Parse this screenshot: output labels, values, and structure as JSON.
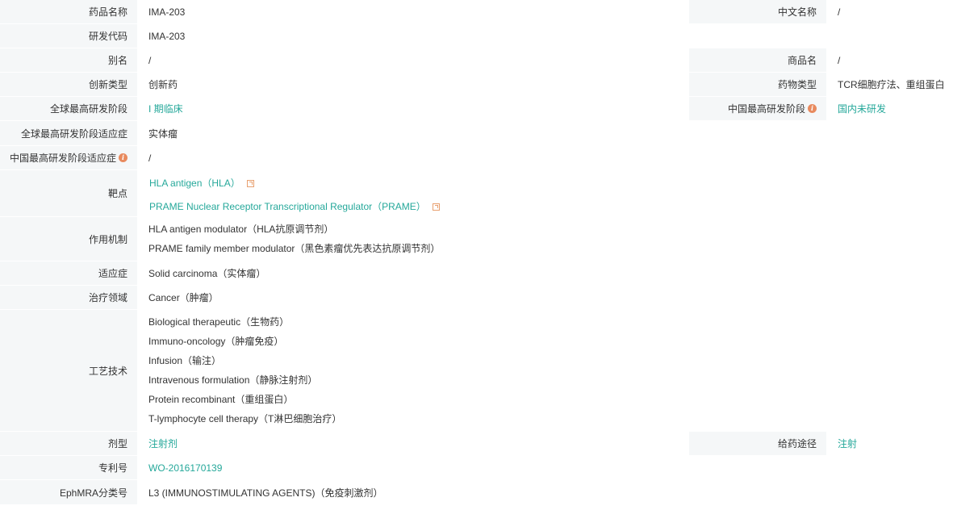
{
  "labels": {
    "drug_name": "药品名称",
    "chinese_name": "中文名称",
    "rd_code": "研发代码",
    "alias": "别名",
    "trade_name": "商品名",
    "innovation_type": "创新类型",
    "drug_type": "药物类型",
    "global_highest_phase": "全球最高研发阶段",
    "china_highest_phase": "中国最高研发阶段",
    "global_phase_indication": "全球最高研发阶段适应症",
    "china_phase_indication": "中国最高研发阶段适应症",
    "target": "靶点",
    "mechanism": "作用机制",
    "indication": "适应症",
    "therapeutic_area": "治疗领域",
    "technology": "工艺技术",
    "dosage_form": "剂型",
    "route": "给药途径",
    "patent": "专利号",
    "ephmra": "EphMRA分类号"
  },
  "values": {
    "drug_name": "IMA-203",
    "chinese_name": "/",
    "rd_code": "IMA-203",
    "alias": "/",
    "trade_name": "/",
    "innovation_type": "创新药",
    "drug_type": "TCR细胞疗法、重组蛋白",
    "global_highest_phase": "I 期临床",
    "china_highest_phase": "国内未研发",
    "global_phase_indication": "实体瘤",
    "china_phase_indication": "/",
    "targets": [
      "HLA antigen（HLA）",
      "PRAME Nuclear Receptor Transcriptional Regulator（PRAME）"
    ],
    "mechanisms": [
      "HLA antigen modulator（HLA抗原调节剂）",
      "PRAME family member modulator（黑色素瘤优先表达抗原调节剂）"
    ],
    "indication": "Solid carcinoma（实体瘤）",
    "therapeutic_area": "Cancer（肿瘤）",
    "technologies": [
      "Biological therapeutic（生物药）",
      "Immuno-oncology（肿瘤免疫）",
      "Infusion（输注）",
      "Intravenous formulation（静脉注射剂）",
      "Protein recombinant（重组蛋白）",
      "T-lymphocyte cell therapy（T淋巴细胞治疗）"
    ],
    "dosage_form": "注射剂",
    "route": "注射",
    "patent": "WO-2016170139",
    "ephmra": "L3 (IMMUNOSTIMULATING AGENTS)（免疫刺激剂）"
  },
  "colors": {
    "label_bg": "#f5f7f8",
    "link": "#25a89a",
    "info_icon": "#e88a5e"
  }
}
